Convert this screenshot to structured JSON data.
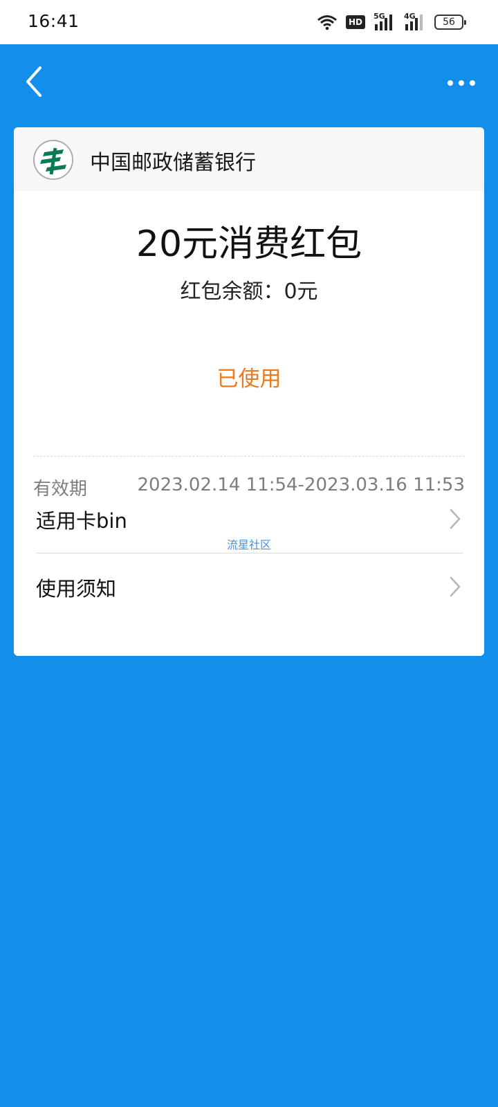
{
  "status_bar": {
    "time": "16:41",
    "hd_label": "HD",
    "signal_1_label": "5G",
    "signal_2_label": "4G",
    "battery_level": "56",
    "icons": [
      "wifi-icon",
      "hd-icon",
      "signal-5g-icon",
      "signal-4g-icon",
      "battery-icon"
    ]
  },
  "nav": {
    "back_icon": "chevron-left-icon",
    "more_icon": "more-dots-icon"
  },
  "card": {
    "bank_name": "中国邮政储蓄银行",
    "bank_logo": "postal-savings-bank-logo",
    "title": "20元消费红包",
    "balance_label": "红包余额：",
    "balance_value": "0元",
    "status": "已使用",
    "validity_label": "有效期",
    "validity_value": "2023.02.14 11:54-2023.03.16 11:53",
    "rows": [
      {
        "label": "适用卡bin",
        "icon": "chevron-right-icon"
      },
      {
        "label": "使用须知",
        "icon": "chevron-right-icon"
      }
    ],
    "watermark": "流星社区"
  },
  "colors": {
    "background": "#138eea",
    "status_used": "#ec7a1c",
    "card": "#ffffff"
  }
}
